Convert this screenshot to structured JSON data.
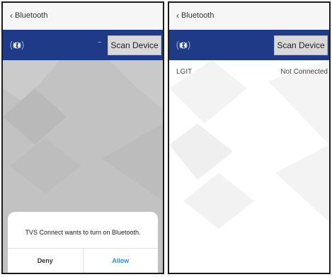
{
  "screens": [
    {
      "nav": {
        "back_label": "Bluetooth"
      },
      "toolbar": {
        "scan_label": "Scan Device",
        "indicator": "~"
      },
      "dialog": {
        "message": "TVS Connect wants to turn on Bluetooth.",
        "deny_label": "Deny",
        "allow_label": "Allow"
      }
    },
    {
      "nav": {
        "back_label": "Bluetooth"
      },
      "toolbar": {
        "scan_label": "Scan Device"
      },
      "devices": [
        {
          "name": "LGIT",
          "status": "Not Connected"
        }
      ]
    }
  ],
  "icons": {
    "back": "chevron-left-icon",
    "bluetooth": "bluetooth-signal-icon"
  },
  "colors": {
    "toolbar_bg": "#1f3b87",
    "overlay_bg": "#c2c2c2",
    "allow_text": "#2e8ef0",
    "scan_button_bg": "#d9d9d9"
  }
}
